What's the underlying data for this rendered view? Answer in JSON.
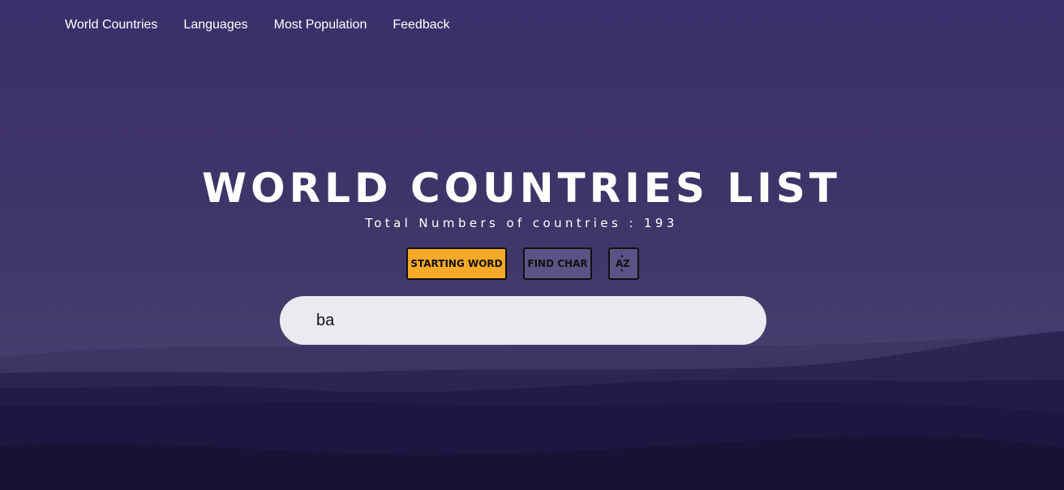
{
  "nav": {
    "items": [
      {
        "label": "World Countries"
      },
      {
        "label": "Languages"
      },
      {
        "label": "Most Population"
      },
      {
        "label": "Feedback"
      }
    ]
  },
  "header": {
    "title": "WORLD COUNTRIES LIST",
    "subtitle": "Total Numbers of countries : 193"
  },
  "controls": {
    "starting_word_label": "STARTING WORD",
    "find_char_label": "FIND CHAR",
    "sort_icon": "sort-alpha-icon"
  },
  "search": {
    "value": "ba"
  },
  "colors": {
    "active_button": "#f7a928",
    "button": "#5b5285",
    "background": "#3f3568"
  }
}
